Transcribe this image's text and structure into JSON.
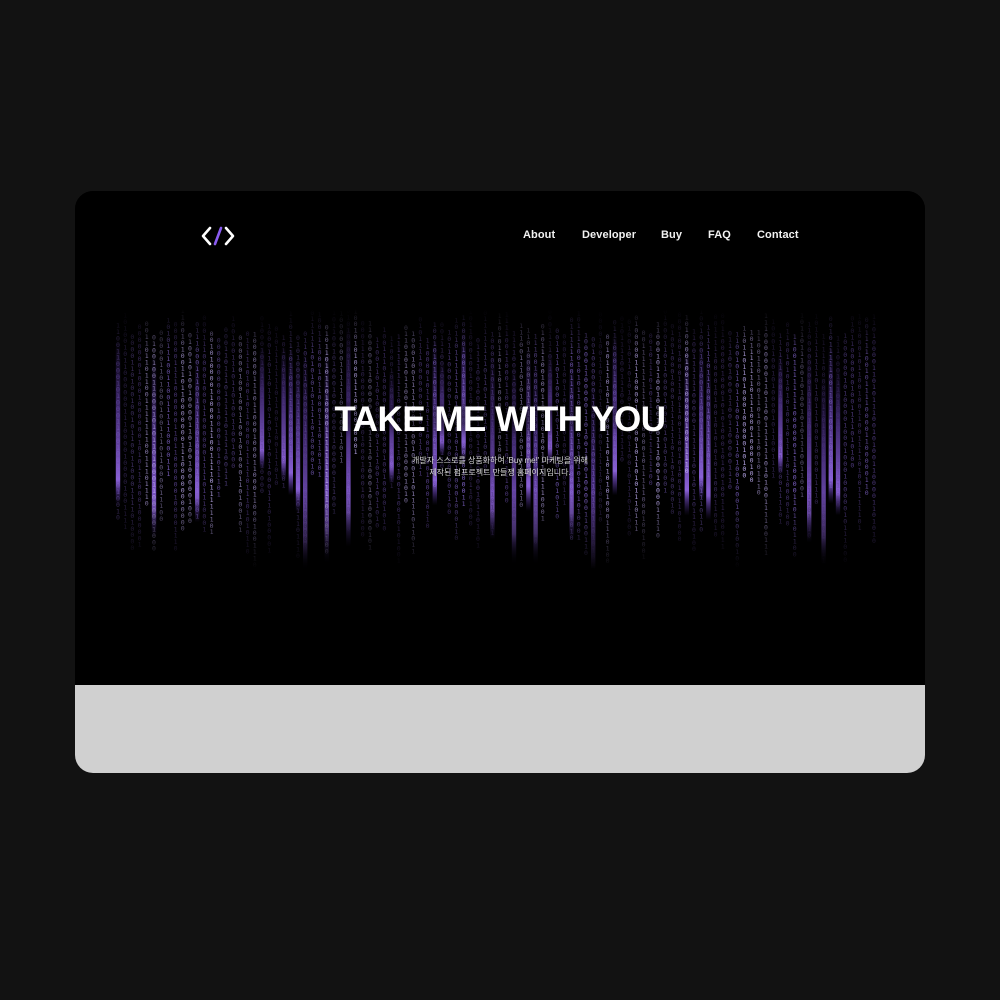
{
  "colors": {
    "page_background": "#121212",
    "hero_background": "#000000",
    "footer_background": "#d0d0d0",
    "accent_purple": "#7b4fd6",
    "nav_text": "#f2f2f2"
  },
  "logo": {
    "icon": "code-brackets-icon"
  },
  "nav": {
    "items": [
      {
        "label": "About"
      },
      {
        "label": "Developer"
      },
      {
        "label": "Buy"
      },
      {
        "label": "FAQ"
      },
      {
        "label": "Contact"
      }
    ]
  },
  "hero": {
    "title": "TAKE ME WITH YOU",
    "subtitle_line1": "개발자 스스로를 상품화하여 'Buy me!' 마케팅을 위해",
    "subtitle_line2": "제작된 펌프로젝트 만들쟁 홈페이지입니다.",
    "background_effect": "binary-code-rain"
  }
}
